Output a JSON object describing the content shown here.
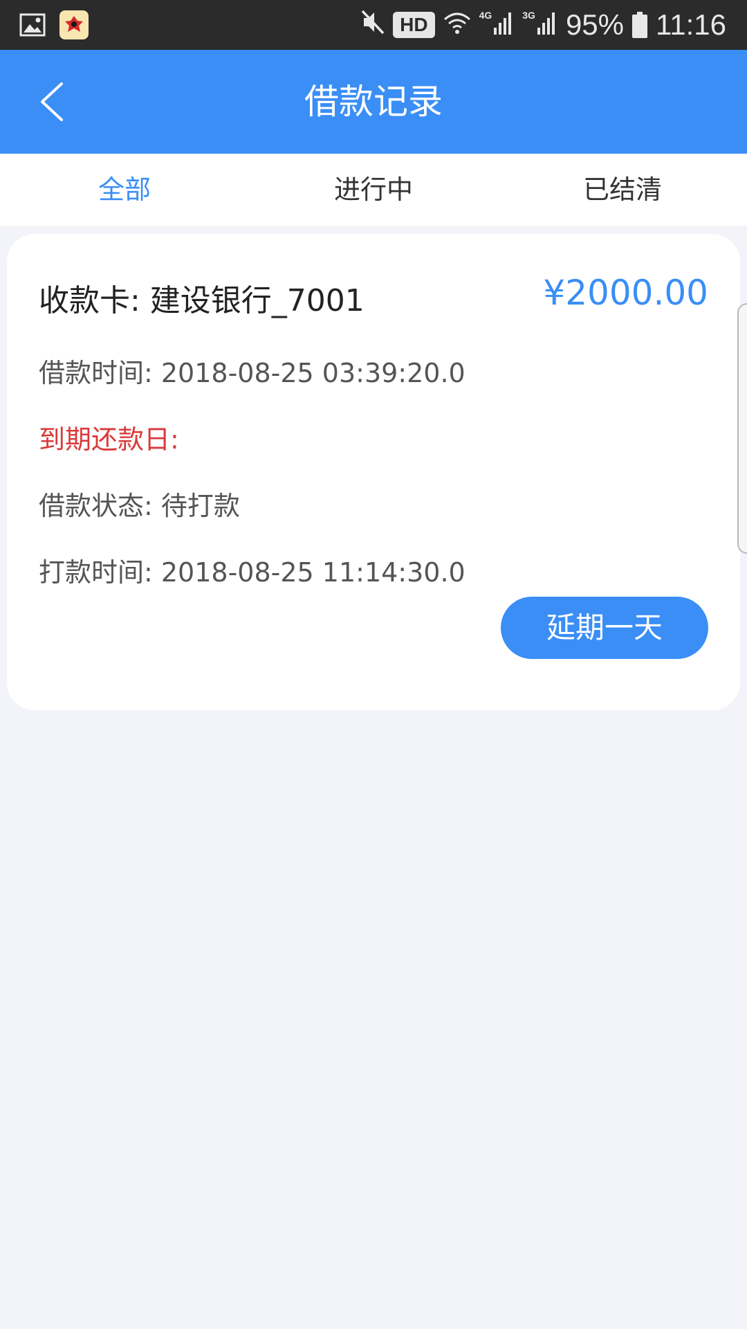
{
  "status_bar": {
    "network_4g": "4G",
    "network_3g": "3G",
    "hd": "HD",
    "battery": "95%",
    "time": "11:16"
  },
  "header": {
    "title": "借款记录"
  },
  "tabs": [
    {
      "label": "全部",
      "active": true
    },
    {
      "label": "进行中",
      "active": false
    },
    {
      "label": "已结清",
      "active": false
    }
  ],
  "loan": {
    "card_text": "收款卡: 建设银行_7001",
    "amount": "¥2000.00",
    "loan_time": "借款时间: 2018-08-25 03:39:20.0",
    "due_date": "到期还款日:",
    "status": "借款状态: 待打款",
    "payout_time": "打款时间: 2018-08-25 11:14:30.0",
    "extend_label": "延期一天"
  },
  "colors": {
    "primary": "#3a8ef6",
    "due": "#d93a3a",
    "background": "#f2f4f9",
    "status_bar": "#2b2b2b"
  }
}
